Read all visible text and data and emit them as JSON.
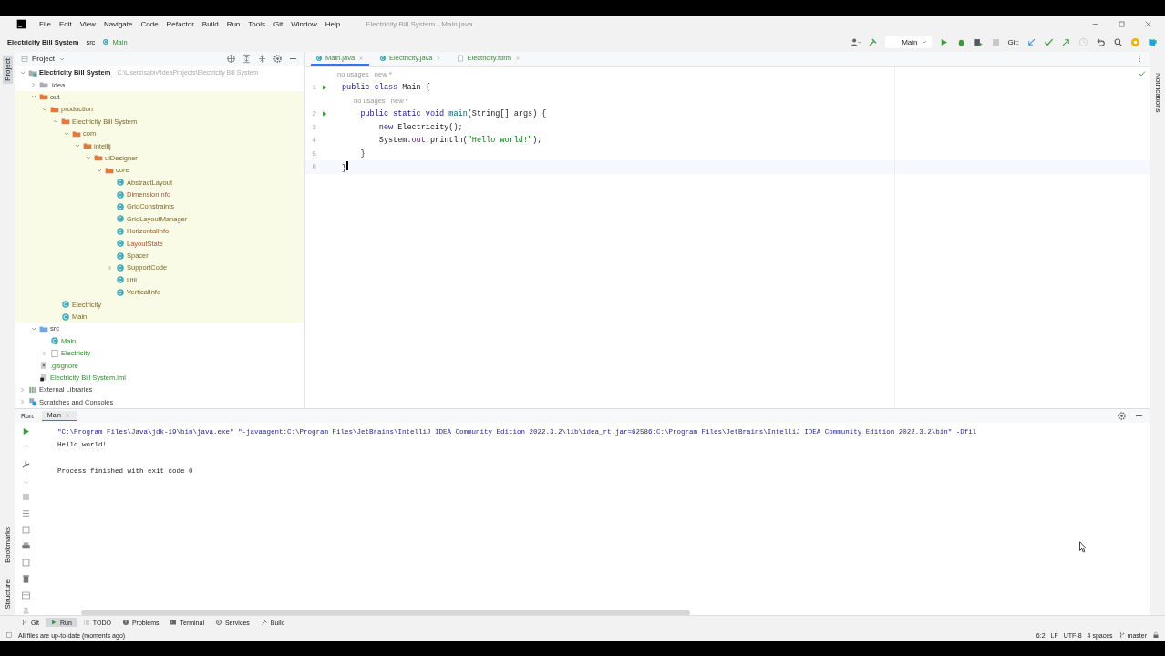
{
  "window": {
    "title": "Electricity Bill System - Main.java"
  },
  "menu": [
    "File",
    "Edit",
    "View",
    "Navigate",
    "Code",
    "Refactor",
    "Build",
    "Run",
    "Tools",
    "Git",
    "Window",
    "Help"
  ],
  "breadcrumb": [
    {
      "label": "Electricity Bill System",
      "kind": "project"
    },
    {
      "label": "src",
      "kind": "folder"
    },
    {
      "label": "Main",
      "kind": "class"
    }
  ],
  "toolbar": {
    "run_config": "Main",
    "vcs_label": "Git:"
  },
  "side_labels": {
    "left_top": [
      {
        "label": "Project",
        "selected": true
      }
    ],
    "left_bottom": [
      {
        "label": "Bookmarks",
        "selected": false
      },
      {
        "label": "Structure",
        "selected": false
      }
    ],
    "right": [
      {
        "label": "Notifications",
        "selected": false
      }
    ]
  },
  "project_panel": {
    "title": "Project",
    "tree": [
      {
        "label": "Electricity Bill System",
        "kind": "project",
        "path": "C:\\Users\\sabiv\\IdeaProjects\\Electricity Bill System",
        "expanded": true,
        "children": [
          {
            "label": ".idea",
            "kind": "folder",
            "expanded": false,
            "excluded": false,
            "ignored": false,
            "added": false
          },
          {
            "label": "out",
            "kind": "excluded",
            "expanded": true,
            "excluded": false,
            "ignored": false,
            "added": false,
            "children": [
              {
                "label": "production",
                "kind": "excluded",
                "expanded": true,
                "excluded": true,
                "ignored": false,
                "added": false,
                "children": [
                  {
                    "label": "Electricity Bill System",
                    "kind": "excluded",
                    "expanded": true,
                    "excluded": true,
                    "ignored": false,
                    "added": false,
                    "children": [
                      {
                        "label": "com",
                        "kind": "excluded",
                        "expanded": true,
                        "excluded": true,
                        "ignored": false,
                        "added": false,
                        "children": [
                          {
                            "label": "intellij",
                            "kind": "excluded",
                            "expanded": true,
                            "excluded": true,
                            "ignored": false,
                            "added": false,
                            "children": [
                              {
                                "label": "uiDesigner",
                                "kind": "excluded",
                                "expanded": true,
                                "excluded": true,
                                "ignored": false,
                                "added": false,
                                "children": [
                                  {
                                    "label": "core",
                                    "kind": "excluded",
                                    "expanded": true,
                                    "excluded": true,
                                    "ignored": false,
                                    "added": false,
                                    "children": [
                                      {
                                        "label": "AbstractLayout",
                                        "kind": "class",
                                        "excluded": true,
                                        "ignored": false,
                                        "added": false
                                      },
                                      {
                                        "label": "DimensionInfo",
                                        "kind": "class",
                                        "excluded": false,
                                        "ignored": true,
                                        "added": false
                                      },
                                      {
                                        "label": "GridConstraints",
                                        "kind": "class",
                                        "excluded": true,
                                        "ignored": false,
                                        "added": false
                                      },
                                      {
                                        "label": "GridLayoutManager",
                                        "kind": "class",
                                        "excluded": true,
                                        "ignored": false,
                                        "added": false
                                      },
                                      {
                                        "label": "HorizontalInfo",
                                        "kind": "class",
                                        "excluded": false,
                                        "ignored": true,
                                        "added": false
                                      },
                                      {
                                        "label": "LayoutState",
                                        "kind": "class",
                                        "excluded": false,
                                        "ignored": true,
                                        "added": false
                                      },
                                      {
                                        "label": "Spacer",
                                        "kind": "class",
                                        "excluded": true,
                                        "ignored": false,
                                        "added": false
                                      },
                                      {
                                        "label": "SupportCode",
                                        "kind": "class",
                                        "expanded": false,
                                        "excluded": true,
                                        "ignored": false,
                                        "added": false
                                      },
                                      {
                                        "label": "Util",
                                        "kind": "class",
                                        "excluded": true,
                                        "ignored": false,
                                        "added": false
                                      },
                                      {
                                        "label": "VerticalInfo",
                                        "kind": "class",
                                        "excluded": true,
                                        "ignored": false,
                                        "added": false
                                      }
                                    ]
                                  }
                                ]
                              }
                            ]
                          }
                        ]
                      }
                    ]
                  },
                  {
                    "label": "Electricity",
                    "kind": "class",
                    "excluded": true,
                    "ignored": false,
                    "added": false
                  },
                  {
                    "label": "Main",
                    "kind": "class",
                    "excluded": true,
                    "ignored": false,
                    "added": false
                  }
                ]
              }
            ]
          },
          {
            "label": "src",
            "kind": "source",
            "expanded": true,
            "excluded": false,
            "ignored": false,
            "added": false,
            "children": [
              {
                "label": "Main",
                "kind": "main-class",
                "excluded": false,
                "ignored": false,
                "added": true
              },
              {
                "label": "Electricity",
                "kind": "form",
                "expanded": false,
                "excluded": false,
                "ignored": false,
                "added": true
              }
            ]
          },
          {
            "label": ".gitignore",
            "kind": "file",
            "excluded": false,
            "ignored": false,
            "added": true
          },
          {
            "label": "Electricity Bill System.iml",
            "kind": "module",
            "excluded": false,
            "ignored": false,
            "added": true
          }
        ]
      },
      {
        "label": "External Libraries",
        "kind": "library",
        "expanded": false,
        "excluded": false,
        "ignored": false,
        "added": false
      },
      {
        "label": "Scratches and Consoles",
        "kind": "scratches",
        "expanded": false,
        "excluded": false,
        "ignored": false,
        "added": false
      }
    ]
  },
  "editor_tabs": [
    {
      "label": "Main.java",
      "kind": "class",
      "selected": true
    },
    {
      "label": "Electricity.java",
      "kind": "class",
      "selected": false
    },
    {
      "label": "Electricity.form",
      "kind": "form",
      "selected": false
    }
  ],
  "code": [
    {
      "number": "1",
      "hint": "no usages   new *",
      "runnable": true,
      "tokens": [
        {
          "text": "public class ",
          "kind": "keyword"
        },
        {
          "text": "Main {",
          "kind": "plain"
        }
      ]
    },
    {
      "number": "2",
      "hint": "no usages   new *",
      "runnable": true,
      "tokens": [
        {
          "text": "    public static void ",
          "kind": "keyword"
        },
        {
          "text": "main",
          "kind": "method"
        },
        {
          "text": "(String[] args) {",
          "kind": "plain"
        }
      ]
    },
    {
      "number": "3",
      "runnable": false,
      "tokens": [
        {
          "text": "        new ",
          "kind": "keyword"
        },
        {
          "text": "Electricity();",
          "kind": "plain"
        }
      ]
    },
    {
      "number": "4",
      "runnable": false,
      "tokens": [
        {
          "text": "        System.",
          "kind": "plain"
        },
        {
          "text": "out",
          "kind": "field"
        },
        {
          "text": ".println(",
          "kind": "plain"
        },
        {
          "text": "\"Hello world!\"",
          "kind": "string"
        },
        {
          "text": ");",
          "kind": "plain"
        }
      ]
    },
    {
      "number": "5",
      "runnable": false,
      "tokens": [
        {
          "text": "    }",
          "kind": "plain"
        }
      ]
    },
    {
      "number": "6",
      "runnable": false,
      "current": true,
      "tokens": [
        {
          "text": "}",
          "kind": "plain"
        }
      ]
    }
  ],
  "run_panel": {
    "label": "Run:",
    "tab": "Main",
    "console": [
      {
        "text": "\"C:\\Program Files\\Java\\jdk-19\\bin\\java.exe\" \"-javaagent:C:\\Program Files\\JetBrains\\IntelliJ IDEA Community Edition 2022.3.2\\lib\\idea_rt.jar=62586:C:\\Program Files\\JetBrains\\IntelliJ IDEA Community Edition 2022.3.2\\bin\" -Dfil",
        "kind": "command"
      },
      {
        "text": "Hello world!",
        "kind": "output"
      },
      {
        "kind": "blank"
      },
      {
        "text": "Process finished with exit code 0",
        "kind": "output"
      }
    ]
  },
  "tool_tabs": [
    {
      "label": "Git",
      "kind": "git",
      "selected": false
    },
    {
      "label": "Run",
      "kind": "run",
      "selected": true
    },
    {
      "label": "TODO",
      "kind": "todo",
      "selected": false
    },
    {
      "label": "Problems",
      "kind": "problems",
      "selected": false
    },
    {
      "label": "Terminal",
      "kind": "terminal",
      "selected": false
    },
    {
      "label": "Services",
      "kind": "services",
      "selected": false
    },
    {
      "label": "Build",
      "kind": "build",
      "selected": false
    }
  ],
  "status_bar": {
    "message": "All files are up-to-date (moments ago)",
    "position": "6:2",
    "line_separator": "LF",
    "encoding": "UTF-8",
    "indent": "4 spaces",
    "branch": "master"
  }
}
